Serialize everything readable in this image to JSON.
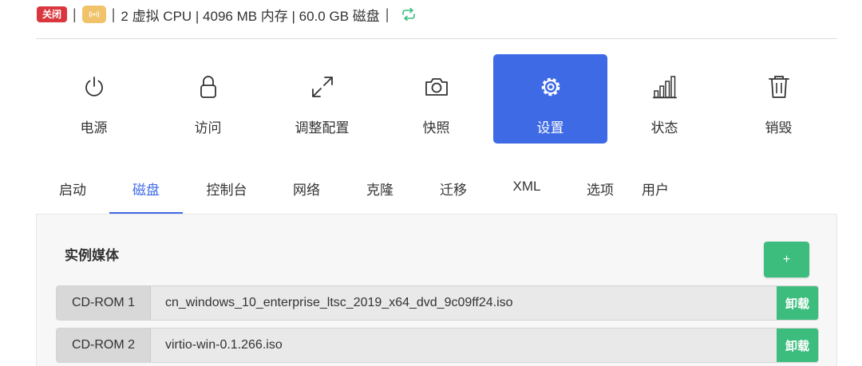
{
  "status": {
    "state_badge": "关闭",
    "vnc_icon": "broadcast-icon",
    "specs": "2 虚拟 CPU | 4096 MB 内存 | 60.0 GB 磁盘",
    "separator": "|",
    "colors": {
      "off": "#d9363e",
      "vnc": "#f0c36b",
      "refresh": "#3dbd7d"
    }
  },
  "actions": [
    {
      "label": "电源",
      "icon": "power-icon"
    },
    {
      "label": "访问",
      "icon": "lock-icon"
    },
    {
      "label": "调整配置",
      "icon": "resize-icon"
    },
    {
      "label": "快照",
      "icon": "camera-icon"
    },
    {
      "label": "设置",
      "icon": "gear-icon",
      "active": true
    },
    {
      "label": "状态",
      "icon": "bar-chart-icon"
    },
    {
      "label": "销毁",
      "icon": "trash-icon"
    }
  ],
  "tabs": [
    {
      "label": "启动"
    },
    {
      "label": "磁盘",
      "active": true
    },
    {
      "label": "控制台"
    },
    {
      "label": "网络"
    },
    {
      "label": "克隆"
    },
    {
      "label": "迁移"
    },
    {
      "label": "XML"
    },
    {
      "label": "选项"
    },
    {
      "label": "用户"
    }
  ],
  "panel": {
    "title": "实例媒体",
    "add_label": "+",
    "media": [
      {
        "device": "CD-ROM 1",
        "file": "cn_windows_10_enterprise_ltsc_2019_x64_dvd_9c09ff24.iso",
        "action": "卸载"
      },
      {
        "device": "CD-ROM 2",
        "file": "virtio-win-0.1.266.iso",
        "action": "卸载"
      }
    ]
  },
  "accent": "#3e6ae6"
}
